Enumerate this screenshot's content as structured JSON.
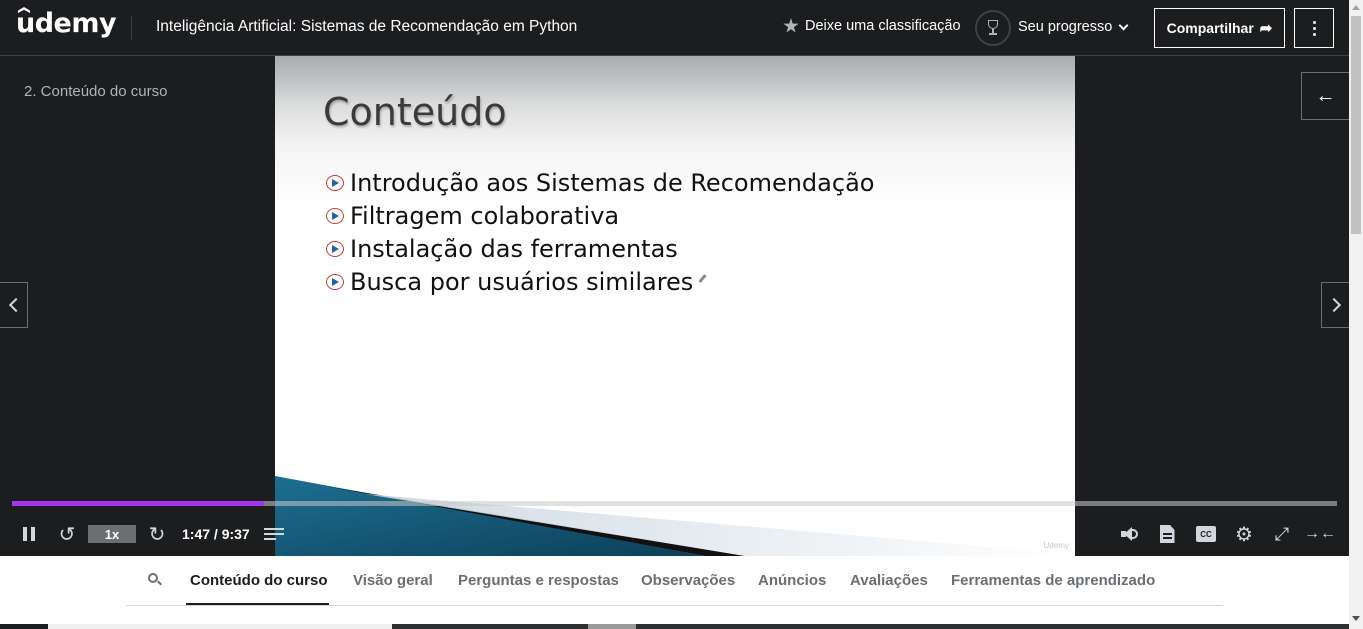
{
  "header": {
    "logo_text": "udemy",
    "course_title": "Inteligência Artificial: Sistemas de Recomendação em Python",
    "rate_label": "Deixe uma classificação",
    "progress_label": "Seu progresso",
    "share_label": "Compartilhar",
    "share_icon": "share-arrow-icon",
    "more_icon": "vertical-dots-icon"
  },
  "player": {
    "lecture_label": "2. Conteúdo do curso",
    "slide": {
      "title": "Conteúdo",
      "bullets": [
        "Introdução aos Sistemas de Recomendação",
        "Filtragem colaborativa",
        "Instalação das ferramentas",
        "Busca por usuários similares"
      ],
      "watermark": "Udemy"
    },
    "controls": {
      "speed": "1x",
      "time": "1:47 / 9:37",
      "progress_fraction": 0.19
    }
  },
  "tabs": {
    "items": [
      "Conteúdo do curso",
      "Visão geral",
      "Perguntas e respostas",
      "Observações",
      "Anúncios",
      "Avaliações",
      "Ferramentas de aprendizado"
    ],
    "active_index": 0
  },
  "colors": {
    "brand_purple": "#a435f0",
    "dark_bg": "#1c1d1f",
    "muted_text": "#6a6f73"
  }
}
